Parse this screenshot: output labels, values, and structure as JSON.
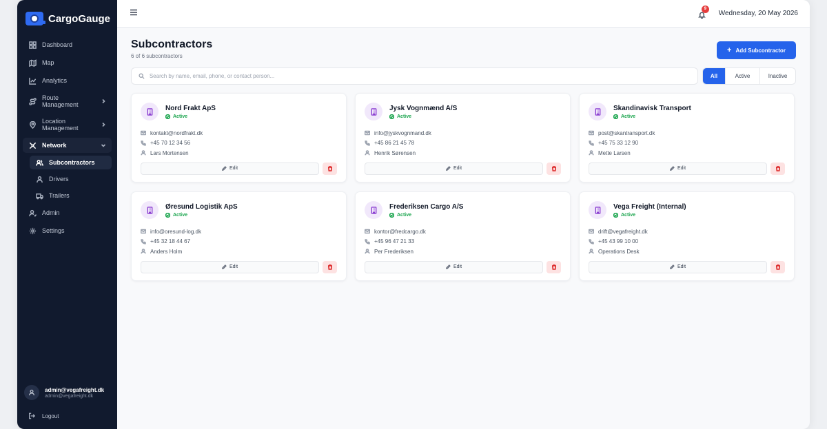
{
  "app": {
    "name": "CargoGauge"
  },
  "sidebar": {
    "items": [
      {
        "id": "dashboard",
        "label": "Dashboard",
        "icon": "grid-icon"
      },
      {
        "id": "map",
        "label": "Map",
        "icon": "map-icon"
      },
      {
        "id": "analytics",
        "label": "Analytics",
        "icon": "chart-icon"
      },
      {
        "id": "route-management",
        "label": "Route Management",
        "icon": "route-icon"
      },
      {
        "id": "location-management",
        "label": "Location Management",
        "icon": "pin-icon"
      },
      {
        "id": "network",
        "label": "Network",
        "icon": "network-icon"
      }
    ],
    "network_children": [
      {
        "id": "subcontractors",
        "label": "Subcontractors",
        "icon": "users-icon"
      },
      {
        "id": "drivers",
        "label": "Drivers",
        "icon": "user-icon"
      },
      {
        "id": "trailers",
        "label": "Trailers",
        "icon": "truck-icon"
      }
    ],
    "bottom_items": [
      {
        "id": "admin",
        "label": "Admin",
        "icon": "admin-icon"
      },
      {
        "id": "settings",
        "label": "Settings",
        "icon": "gear-icon"
      }
    ],
    "user": {
      "name": "admin@vegafreight.dk",
      "email": "admin@vegafreight.dk"
    },
    "logout_label": "Logout"
  },
  "topbar": {
    "notification_count": "9",
    "date": "Wednesday, 20 May 2026"
  },
  "page": {
    "title": "Subcontractors",
    "subtitle": "6 of 6 subcontractors",
    "add_button_label": "Add Subcontractor",
    "search_placeholder": "Search by name, email, phone, or contact person...",
    "filters": {
      "all": "All",
      "active": "Active",
      "inactive": "Inactive"
    },
    "edit_label": "Edit"
  },
  "cards": [
    {
      "name": "Nord Frakt ApS",
      "status": "Active",
      "email": "kontakt@nordfrakt.dk",
      "phone": "+45 70 12 34 56",
      "contact": "Lars Mortensen"
    },
    {
      "name": "Jysk Vognmænd A/S",
      "status": "Active",
      "email": "info@jyskvognmand.dk",
      "phone": "+45 86 21 45 78",
      "contact": "Henrik Sørensen"
    },
    {
      "name": "Skandinavisk Transport",
      "status": "Active",
      "email": "post@skantransport.dk",
      "phone": "+45 75 33 12 90",
      "contact": "Mette Larsen"
    },
    {
      "name": "Øresund Logistik ApS",
      "status": "Active",
      "email": "info@oresund-log.dk",
      "phone": "+45 32 18 44 67",
      "contact": "Anders Holm"
    },
    {
      "name": "Frederiksen Cargo A/S",
      "status": "Active",
      "email": "kontor@fredcargo.dk",
      "phone": "+45 96 47 21 33",
      "contact": "Per Frederiksen"
    },
    {
      "name": "Vega Freight (Internal)",
      "status": "Active",
      "email": "drift@vegafreight.dk",
      "phone": "+45 43 99 10 00",
      "contact": "Operations Desk"
    }
  ]
}
